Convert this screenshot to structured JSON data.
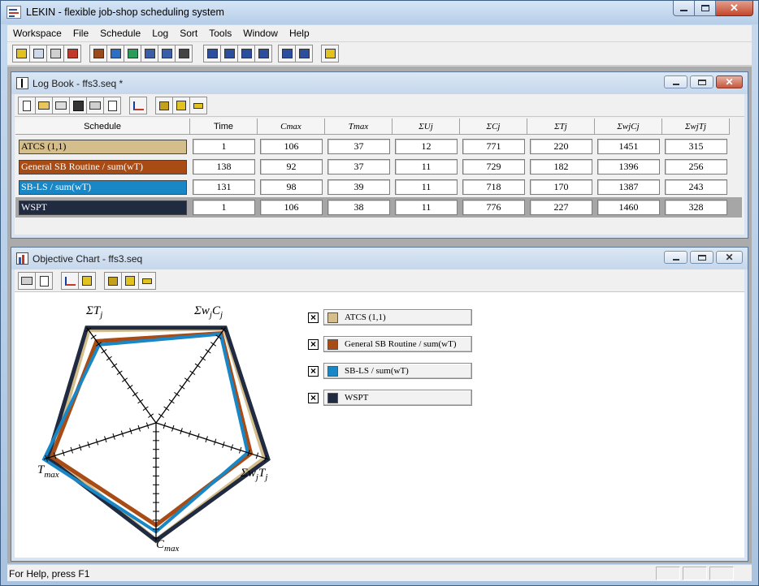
{
  "app": {
    "title": "LEKIN - flexible job-shop scheduling system"
  },
  "menu": [
    {
      "label": "Workspace"
    },
    {
      "label": "File"
    },
    {
      "label": "Schedule"
    },
    {
      "label": "Log"
    },
    {
      "label": "Sort"
    },
    {
      "label": "Tools"
    },
    {
      "label": "Window"
    },
    {
      "label": "Help"
    }
  ],
  "toolbar_icons": [
    "open-workspace-icon",
    "copy-icon",
    "print-icon",
    "routing-icon",
    "machine-icon",
    "tool-icon",
    "globe-icon",
    "machine-gantt-icon",
    "job-gantt-icon",
    "sequence-icon",
    "gantt-chart-icon",
    "gantt-chart-2-icon",
    "gantt-chart-3-icon",
    "gantt-chart-4-icon",
    "grid-icon",
    "windows-icon",
    "help-icon"
  ],
  "logbook": {
    "title": "Log Book - ffs3.seq *",
    "columns": [
      "Schedule",
      "Time",
      "Cmax",
      "Tmax",
      "ΣUj",
      "ΣCj",
      "ΣTj",
      "ΣwjCj",
      "ΣwjTj"
    ],
    "rows": [
      {
        "schedule": "ATCS (1,1)",
        "color": "#d4be8c",
        "text_color": "#000000",
        "values": [
          "1",
          "106",
          "37",
          "12",
          "771",
          "220",
          "1451",
          "315"
        ]
      },
      {
        "schedule": "General SB Routine / sum(wT)",
        "color": "#a84b14",
        "text_color": "#ffffff",
        "values": [
          "138",
          "92",
          "37",
          "11",
          "729",
          "182",
          "1396",
          "256"
        ]
      },
      {
        "schedule": "SB-LS / sum(wT)",
        "color": "#1986c6",
        "text_color": "#ffffff",
        "values": [
          "131",
          "98",
          "39",
          "11",
          "718",
          "170",
          "1387",
          "243"
        ]
      },
      {
        "schedule": "WSPT",
        "color": "#202a40",
        "text_color": "#ffffff",
        "values": [
          "1",
          "106",
          "38",
          "11",
          "776",
          "227",
          "1460",
          "328"
        ]
      }
    ]
  },
  "objective_chart": {
    "title": "Objective Chart - ffs3.seq",
    "legend_mark": "×",
    "axis_labels": {
      "sum_tj": {
        "base": "ΣT",
        "sub": "j"
      },
      "sum_wjcj": {
        "base": "Σw",
        "sub1": "j",
        "mid": "C",
        "sub2": "j"
      },
      "sum_wjtj": {
        "base": "Σw",
        "sub1": "j",
        "mid": "T",
        "sub2": "j"
      },
      "cmax": {
        "base": "C",
        "sub": "max"
      },
      "tmax": {
        "base": "T",
        "sub": "max"
      }
    }
  },
  "chart_data": {
    "type": "radar",
    "axes": [
      "ΣTj",
      "ΣwjCj",
      "ΣwjTj",
      "Cmax",
      "Tmax"
    ],
    "series": [
      {
        "name": "ATCS (1,1)",
        "color": "#d4be8c",
        "values": [
          220,
          1451,
          315,
          106,
          37
        ]
      },
      {
        "name": "General SB Routine / sum(wT)",
        "color": "#a84b14",
        "values": [
          182,
          1396,
          256,
          92,
          37
        ]
      },
      {
        "name": "SB-LS / sum(wT)",
        "color": "#1986c6",
        "values": [
          170,
          1387,
          243,
          98,
          39
        ]
      },
      {
        "name": "WSPT",
        "color": "#202a40",
        "values": [
          227,
          1460,
          328,
          106,
          38
        ]
      }
    ]
  },
  "status": {
    "text": "For Help, press F1"
  }
}
